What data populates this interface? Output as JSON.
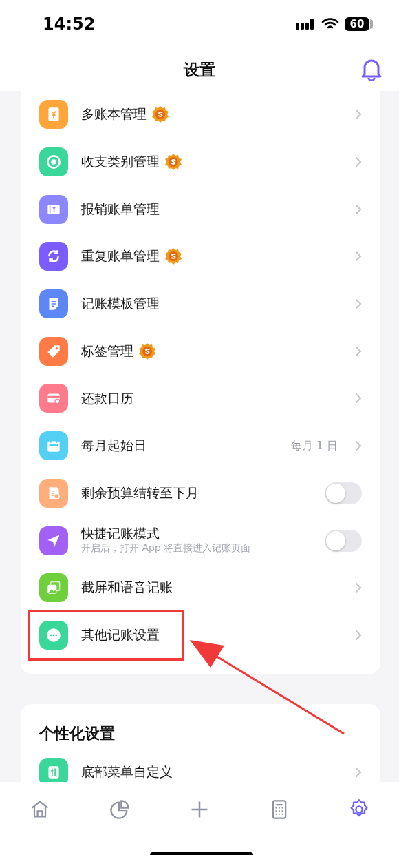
{
  "status_bar": {
    "time": "14:52",
    "battery": "60"
  },
  "header": {
    "title": "设置"
  },
  "sections": [
    {
      "items": [
        {
          "kind": "link",
          "label": "多账本管理",
          "color": "#ffa53a",
          "premium": true,
          "highlighted": false
        },
        {
          "kind": "link",
          "label": "收支类别管理",
          "color": "#3ad79a",
          "premium": true,
          "highlighted": false
        },
        {
          "kind": "link",
          "label": "报销账单管理",
          "color": "#8c86ff",
          "premium": false,
          "highlighted": false
        },
        {
          "kind": "link",
          "label": "重复账单管理",
          "color": "#7b5cff",
          "premium": true,
          "highlighted": false
        },
        {
          "kind": "link",
          "label": "记账模板管理",
          "color": "#5c87f5",
          "premium": false,
          "highlighted": false
        },
        {
          "kind": "link",
          "label": "标签管理",
          "color": "#ff7a45",
          "premium": true,
          "highlighted": false
        },
        {
          "kind": "link",
          "label": "还款日历",
          "color": "#ff7a8a",
          "premium": false,
          "highlighted": false
        },
        {
          "kind": "value",
          "label": "每月起始日",
          "value": "每月 1 日",
          "color": "#55d0f5",
          "premium": false,
          "highlighted": false
        },
        {
          "kind": "toggle",
          "label": "剩余预算结转至下月",
          "on": false,
          "color": "#ffad7a",
          "premium": false,
          "highlighted": false
        },
        {
          "kind": "toggle",
          "label": "快捷记账模式",
          "subtitle": "开启后，打开 App 将直接进入记账页面",
          "on": false,
          "color": "#a260f5",
          "premium": false,
          "highlighted": false
        },
        {
          "kind": "link",
          "label": "截屏和语音记账",
          "color": "#6fcf3c",
          "premium": false,
          "highlighted": false
        },
        {
          "kind": "link",
          "label": "其他记账设置",
          "color": "#3ad79a",
          "premium": false,
          "highlighted": true
        }
      ]
    },
    {
      "title": "个性化设置",
      "items": [
        {
          "kind": "link",
          "label": "底部菜单自定义",
          "color": "#3ad79a",
          "premium": false,
          "highlighted": false
        }
      ]
    }
  ],
  "tab_bar": [
    {
      "selected": false
    },
    {
      "selected": false
    },
    {
      "selected": false
    },
    {
      "selected": false
    },
    {
      "selected": true
    }
  ]
}
